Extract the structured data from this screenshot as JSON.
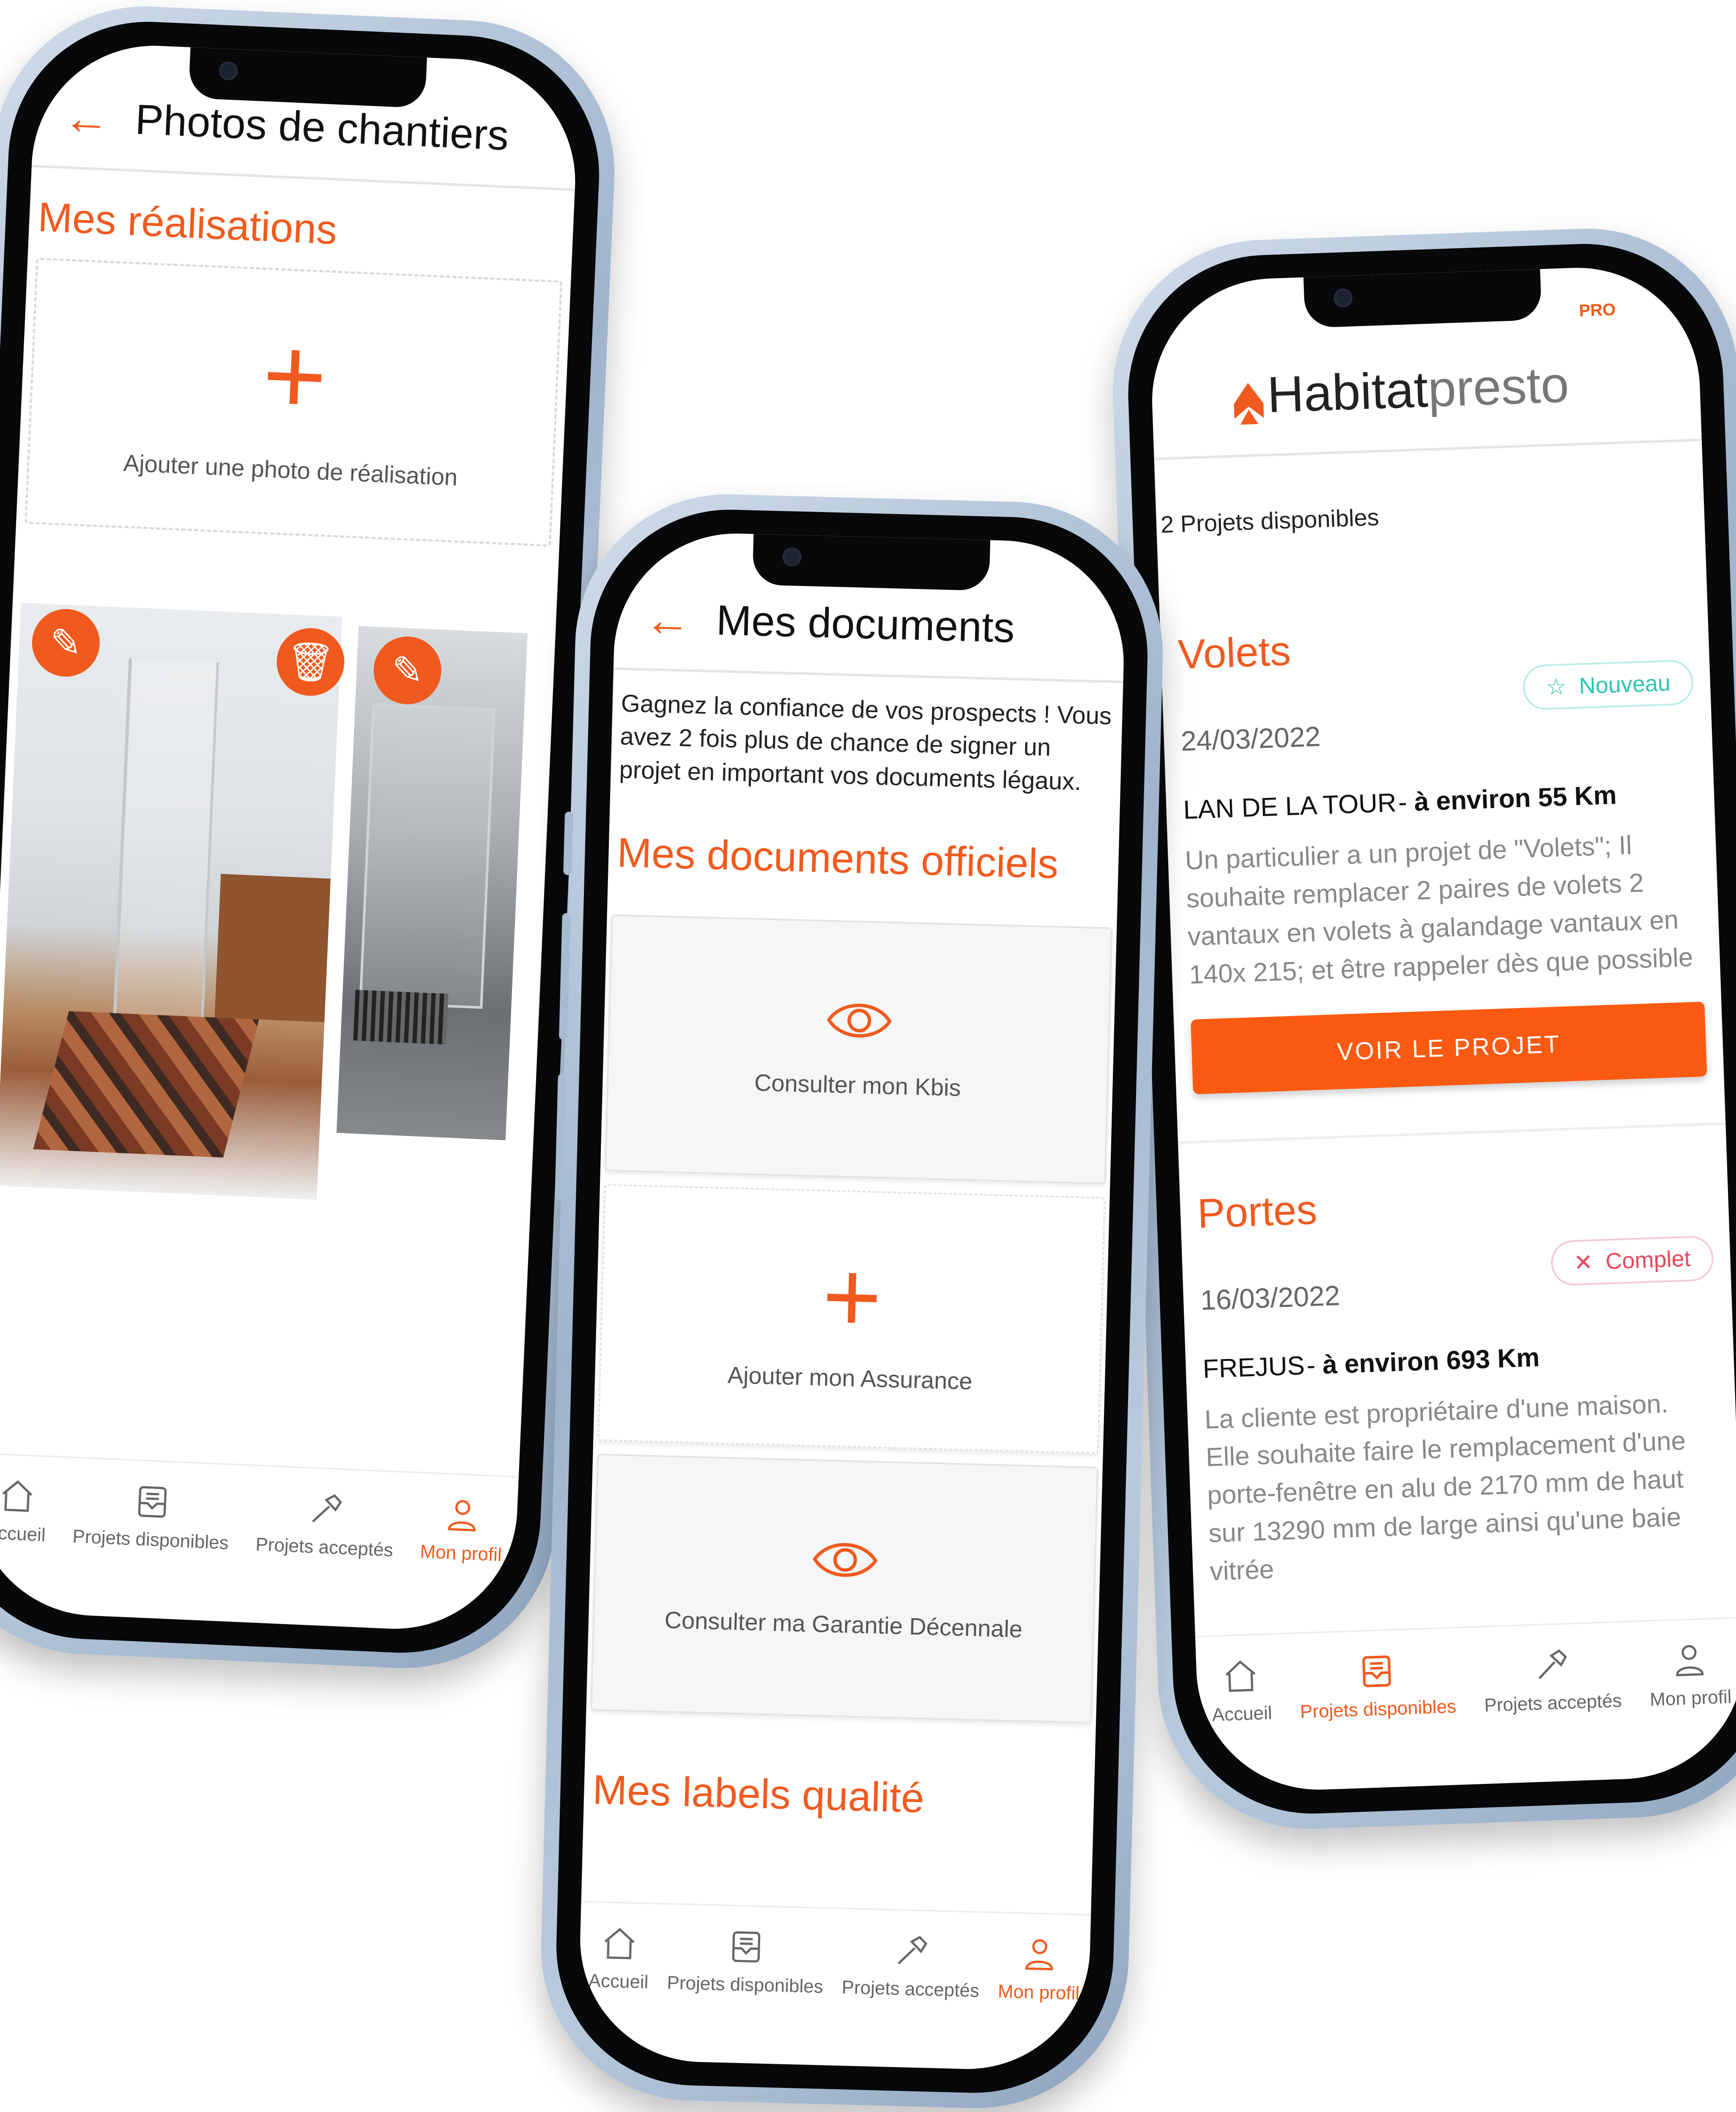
{
  "brand": {
    "accent": "#f15a1e",
    "teal": "#2ec4b6",
    "red": "#e8475c"
  },
  "phone_left": {
    "header": {
      "back_icon": "arrow-left-icon",
      "title": "Photos de chantiers"
    },
    "section_title": "Mes réalisations",
    "add_photo": {
      "icon": "plus-icon",
      "label": "Ajouter une photo de réalisation"
    },
    "photos": [
      {
        "alt": "Salle de bain avec douche vitrée et tapis",
        "edit_icon": "pencil-icon",
        "delete_icon": "trash-icon"
      },
      {
        "alt": "Cabine de douche vitrée",
        "edit_icon": "pencil-icon"
      }
    ],
    "tabbar": [
      {
        "icon": "home-icon",
        "label": "Accueil",
        "active": false
      },
      {
        "icon": "inbox-icon",
        "label": "Projets disponibles",
        "active": false
      },
      {
        "icon": "hammer-icon",
        "label": "Projets acceptés",
        "active": false
      },
      {
        "icon": "user-icon",
        "label": "Mon profil",
        "active": true
      }
    ]
  },
  "phone_middle": {
    "header": {
      "back_icon": "arrow-left-icon",
      "title": "Mes documents"
    },
    "intro": "Gagnez la confiance de vos prospects ! Vous avez 2 fois plus de chance de signer un projet en important vos documents légaux.",
    "section_title": "Mes documents officiels",
    "documents": [
      {
        "icon": "eye-icon",
        "label": "Consulter mon Kbis"
      },
      {
        "icon": "plus-icon",
        "label": "Ajouter mon Assurance"
      },
      {
        "icon": "eye-icon",
        "label": "Consulter ma Garantie Décennale"
      }
    ],
    "next_section_title": "Mes labels qualité",
    "tabbar": [
      {
        "icon": "home-icon",
        "label": "Accueil",
        "active": false
      },
      {
        "icon": "inbox-icon",
        "label": "Projets disponibles",
        "active": false
      },
      {
        "icon": "hammer-icon",
        "label": "Projets acceptés",
        "active": false
      },
      {
        "icon": "user-icon",
        "label": "Mon profil",
        "active": true
      }
    ]
  },
  "phone_right": {
    "logo": {
      "text_dark": "Habitat",
      "text_light": "presto",
      "suffix": "PRO"
    },
    "count_label": "2 Projets disponibles",
    "projects": [
      {
        "category": "Volets",
        "date": "24/03/2022",
        "badge": {
          "icon": "star-icon",
          "label": "Nouveau",
          "type": "new"
        },
        "city": "LAN DE LA TOUR",
        "distance": "à environ 55 Km",
        "description": "Un particulier a un projet de \"Volets\"; Il souhaite remplacer 2 paires de volets 2 vantaux en volets à galandage vantaux en 140x 215; et être rappeler dès que possible",
        "cta": "VOIR LE PROJET"
      },
      {
        "category": "Portes",
        "date": "16/03/2022",
        "badge": {
          "icon": "close-icon",
          "label": "Complet",
          "type": "full"
        },
        "city": "FREJUS",
        "distance": "à environ 693 Km",
        "description": "La cliente est propriétaire d'une maison. Elle souhaite faire le remplacement d'une porte-fenêtre en alu de 2170 mm de haut sur 13290 mm de large ainsi qu'une baie vitrée"
      }
    ],
    "tabbar": [
      {
        "icon": "home-icon",
        "label": "Accueil",
        "active": false
      },
      {
        "icon": "inbox-icon",
        "label": "Projets disponibles",
        "active": true
      },
      {
        "icon": "hammer-icon",
        "label": "Projets acceptés",
        "active": false
      },
      {
        "icon": "user-icon",
        "label": "Mon profil",
        "active": false
      }
    ]
  }
}
